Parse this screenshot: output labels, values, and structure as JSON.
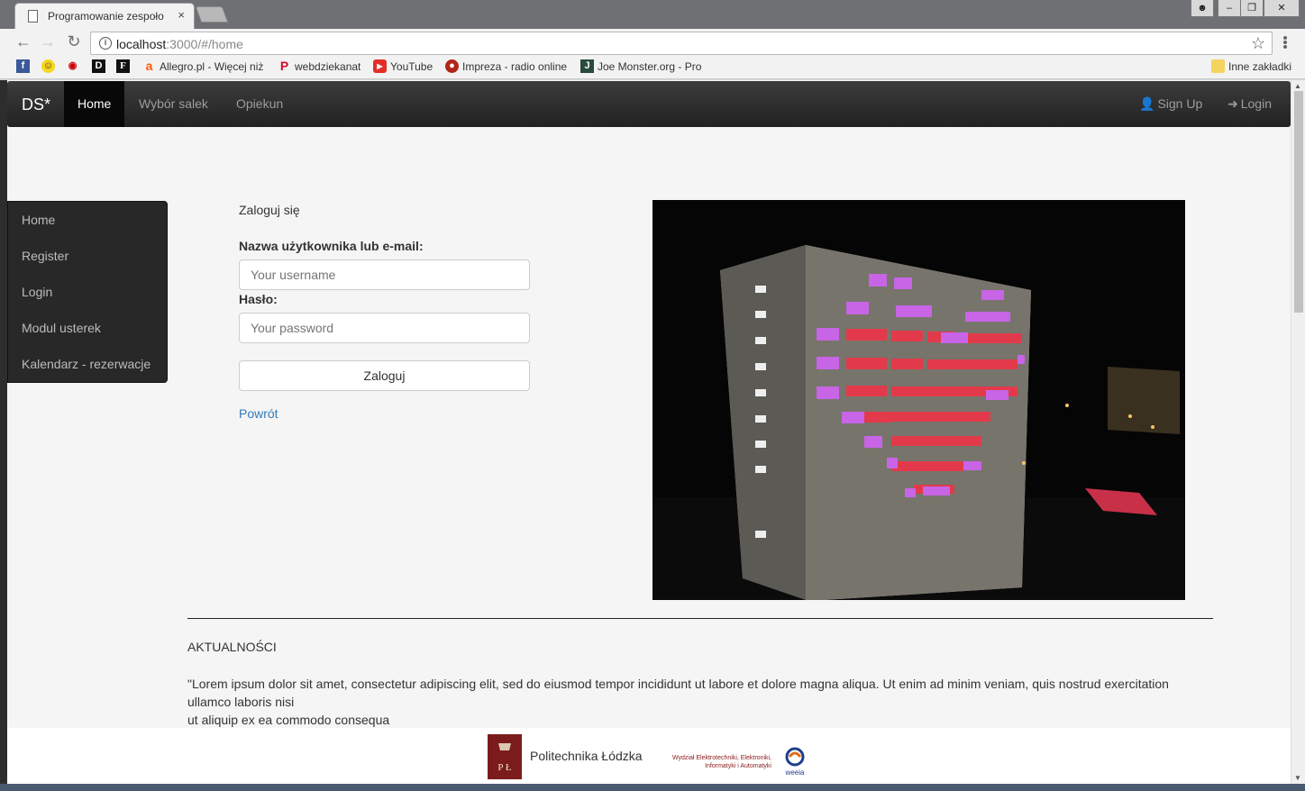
{
  "browser": {
    "tab_title": "Programowanie zespoło",
    "tab_close": "×",
    "url_host": "localhost",
    "url_path": ":3000/#/home",
    "bookmarks": [
      {
        "label": "",
        "icon": "facebook-icon"
      },
      {
        "label": "",
        "icon": "smiley-icon"
      },
      {
        "label": "",
        "icon": "racing-icon"
      },
      {
        "label": "",
        "icon": "dj-icon"
      },
      {
        "label": "",
        "icon": "f-icon"
      },
      {
        "label": "Allegro.pl - Więcej niż",
        "icon": "allegro-icon"
      },
      {
        "label": "webdziekanat",
        "icon": "p-icon"
      },
      {
        "label": "YouTube",
        "icon": "youtube-icon"
      },
      {
        "label": "Impreza - radio online",
        "icon": "radio-icon"
      },
      {
        "label": "Joe Monster.org - Pro",
        "icon": "joemonster-icon"
      },
      {
        "label": "Inne zakładki",
        "icon": "folder-icon"
      }
    ]
  },
  "navbar": {
    "brand": "DS*",
    "items": [
      "Home",
      "Wybór salek",
      "Opiekun"
    ],
    "signup": "Sign Up",
    "login": "Login"
  },
  "sidebar": {
    "items": [
      "Home",
      "Register",
      "Login",
      "Modul usterek",
      "Kalendarz - rezerwacje"
    ]
  },
  "login_form": {
    "heading": "Zaloguj się",
    "username_label": "Nazwa użytkownika lub e-mail:",
    "username_placeholder": "Your username",
    "password_label": "Hasło:",
    "password_placeholder": "Your password",
    "submit": "Zaloguj",
    "back": "Powrót"
  },
  "news": {
    "title": "AKTUALNOŚCI",
    "line1": "\"Lorem ipsum dolor sit amet, consectetur adipiscing elit, sed do eiusmod tempor incididunt ut labore et dolore magna aliqua. Ut enim ad minim veniam, quis nostrud exercitation ullamco laboris nisi",
    "line2": "ut aliquip ex ea commodo consequa"
  },
  "footer": {
    "university": "Politechnika Łódzka",
    "faculty_line1": "Wydział Elektrotechniki, Elektroniki,",
    "faculty_line2": "Informatyki i Automatyki",
    "weeia": "weeia",
    "pl_logo_text": "P Ł"
  },
  "colors": {
    "navbar": "#222222",
    "link": "#337ab7",
    "sidebar": "#282828"
  }
}
